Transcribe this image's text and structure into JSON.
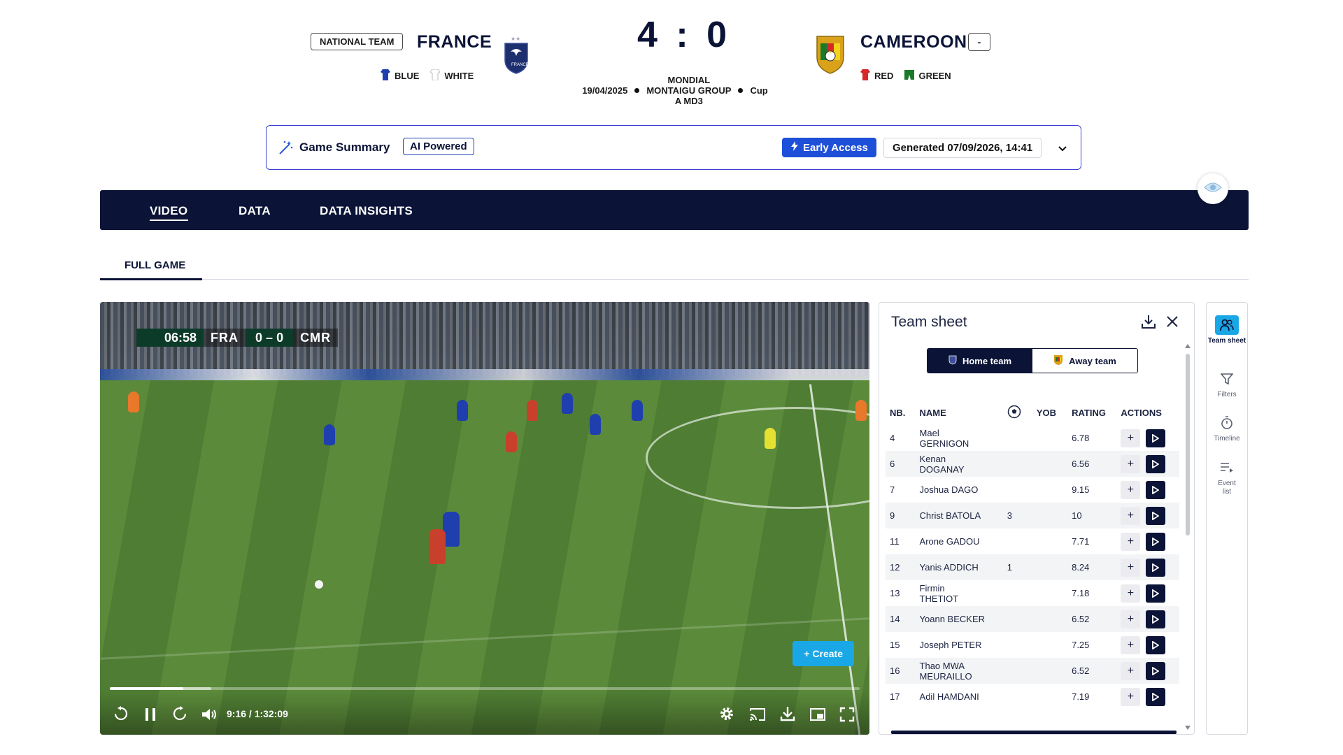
{
  "match": {
    "badge": "NATIONAL TEAM",
    "home": {
      "name": "FRANCE",
      "kit1": "BLUE",
      "kit2": "WHITE",
      "kit1_color": "#1f3fae",
      "kit2_color": "#ffffff"
    },
    "away": {
      "name": "CAMEROON",
      "menu_symbol": "-",
      "kit1": "RED",
      "kit2": "GREEN",
      "kit1_color": "#d62828",
      "kit2_color": "#1b7a2a"
    },
    "score": "4 : 0",
    "date": "19/04/2025",
    "competition_line1": "MONDIAL",
    "competition_line2": "MONTAIGU GROUP",
    "competition_line3": "A MD3",
    "type": "Cup"
  },
  "summary": {
    "title": "Game Summary",
    "ai_badge": "AI Powered",
    "early_access": "Early Access",
    "generated": "Generated 07/09/2026, 14:41"
  },
  "nav": {
    "tabs": [
      {
        "label": "VIDEO",
        "active": true
      },
      {
        "label": "DATA",
        "active": false
      },
      {
        "label": "DATA INSIGHTS",
        "active": false
      }
    ]
  },
  "subtab": {
    "label": "FULL GAME"
  },
  "video": {
    "clock": "06:58",
    "home_abbr": "FRA",
    "score": "0 – 0",
    "away_abbr": "CMR",
    "create_label": "+ Create",
    "time": "9:16 / 1:32:09",
    "played_fraction": 0.098,
    "buffered_fraction": 0.135
  },
  "sheet": {
    "title": "Team sheet",
    "home_label": "Home team",
    "away_label": "Away team",
    "columns": [
      "NB.",
      "NAME",
      "",
      "YOB",
      "RATING",
      "ACTIONS"
    ],
    "players": [
      {
        "nb": "4",
        "name1": "Mael",
        "name2": "GERNIGON",
        "goals": "",
        "yob": "",
        "rating": "6.78"
      },
      {
        "nb": "6",
        "name1": "Kenan",
        "name2": "DOGANAY",
        "goals": "",
        "yob": "",
        "rating": "6.56"
      },
      {
        "nb": "7",
        "name1": "Joshua DAGO",
        "name2": "",
        "goals": "",
        "yob": "",
        "rating": "9.15"
      },
      {
        "nb": "9",
        "name1": "Christ BATOLA",
        "name2": "",
        "goals": "3",
        "yob": "",
        "rating": "10"
      },
      {
        "nb": "11",
        "name1": "Arone GADOU",
        "name2": "",
        "goals": "",
        "yob": "",
        "rating": "7.71"
      },
      {
        "nb": "12",
        "name1": "Yanis ADDICH",
        "name2": "",
        "goals": "1",
        "yob": "",
        "rating": "8.24"
      },
      {
        "nb": "13",
        "name1": "Firmin",
        "name2": "THETIOT",
        "goals": "",
        "yob": "",
        "rating": "7.18"
      },
      {
        "nb": "14",
        "name1": "Yoann BECKER",
        "name2": "",
        "goals": "",
        "yob": "",
        "rating": "6.52"
      },
      {
        "nb": "15",
        "name1": "Joseph PETER",
        "name2": "",
        "goals": "",
        "yob": "",
        "rating": "7.25"
      },
      {
        "nb": "16",
        "name1": "Thao MWA",
        "name2": "MEURAILLO",
        "goals": "",
        "yob": "",
        "rating": "6.52"
      },
      {
        "nb": "17",
        "name1": "Adil HAMDANI",
        "name2": "",
        "goals": "",
        "yob": "",
        "rating": "7.19"
      }
    ]
  },
  "rail": {
    "items": [
      {
        "label": "Team sheet",
        "icon": "users-icon",
        "active": true
      },
      {
        "label": "Filters",
        "icon": "filter-icon",
        "active": false
      },
      {
        "label": "Timeline",
        "icon": "stopwatch-icon",
        "active": false
      },
      {
        "label": "Event list",
        "icon": "list-icon",
        "active": false
      }
    ]
  }
}
